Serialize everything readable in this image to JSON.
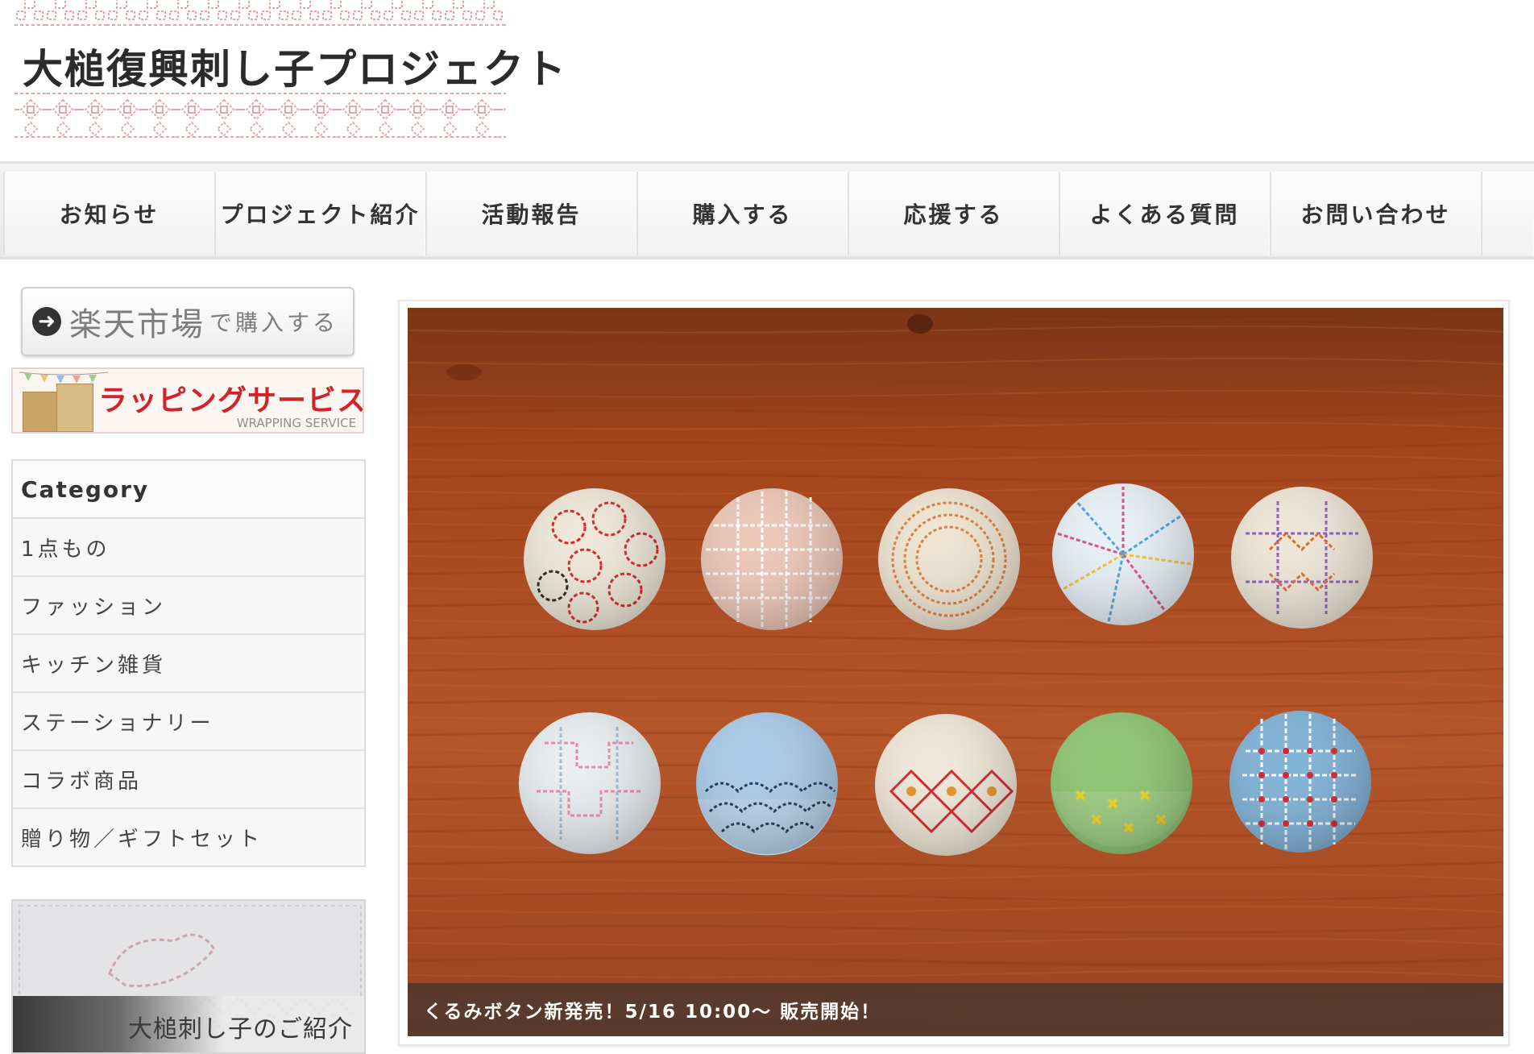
{
  "logo": {
    "title": "大槌復興刺し子プロジェクト"
  },
  "nav": {
    "items": [
      "お知らせ",
      "プロジェクト紹介",
      "活動報告",
      "購入する",
      "応援する",
      "よくある質問",
      "お問い合わせ"
    ]
  },
  "sidebar": {
    "rakuten": {
      "main": "楽天市場",
      "sub": "で購入する"
    },
    "wrapping": {
      "title": "ラッピングサービス",
      "subtitle": "WRAPPING SERVICE"
    },
    "category": {
      "heading": "Category",
      "items": [
        "1点もの",
        "ファッション",
        "キッチン雑貨",
        "ステーショナリー",
        "コラボ商品",
        "贈り物／ギフトセット"
      ]
    },
    "intro_banner": {
      "caption": "大槌刺し子のご紹介"
    }
  },
  "slider": {
    "caption": "くるみボタン新発売！5/16 10:00〜 販売開始！"
  },
  "colors": {
    "logo_pattern": "#e8a3aa",
    "wood": "#b5552a",
    "caption_bg": "#46372f",
    "wrapping_red": "#d2232a"
  }
}
